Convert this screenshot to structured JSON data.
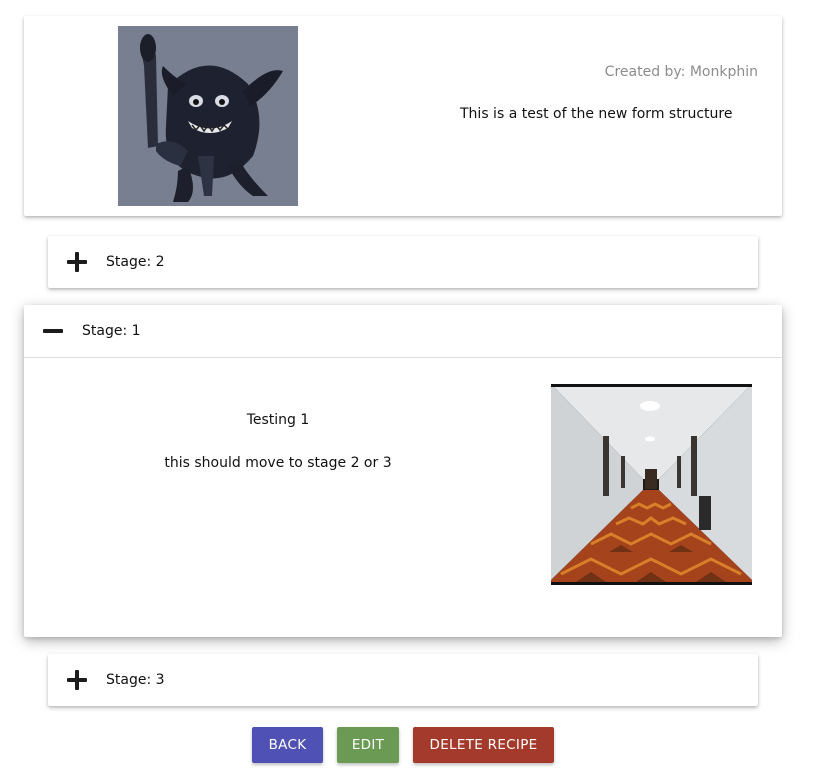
{
  "recipe": {
    "image_alt": "Goblin creature illustration",
    "created_by": "Created by: Monkphin",
    "description": "This is a test of the new form structure"
  },
  "stages": [
    {
      "label": "Stage: 2",
      "expanded": false,
      "toggle_icon": "plus-icon"
    },
    {
      "label": "Stage: 1",
      "expanded": true,
      "toggle_icon": "minus-icon",
      "title": "Testing 1",
      "text": "this should move to stage 2 or 3",
      "image_alt": "Hotel hallway with patterned carpet"
    },
    {
      "label": "Stage: 3",
      "expanded": false,
      "toggle_icon": "plus-icon"
    }
  ],
  "actions": {
    "back_label": "BACK",
    "edit_label": "EDIT",
    "delete_label": "DELETE RECIPE"
  },
  "colors": {
    "back": "#5051b4",
    "edit": "#6a9a54",
    "delete": "#a33a2b",
    "created_by_text": "#8c8c8c"
  }
}
